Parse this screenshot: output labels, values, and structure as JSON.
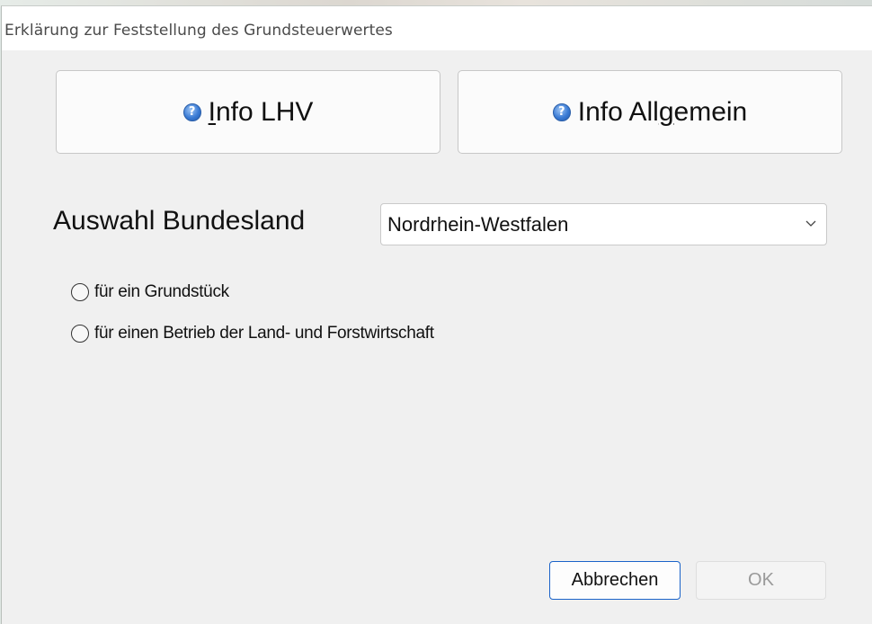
{
  "window": {
    "title": "Erklärung zur Feststellung des Grundsteuerwertes"
  },
  "info_buttons": [
    {
      "label_underlined": "I",
      "label_rest": "nfo LHV",
      "icon": "help-icon"
    },
    {
      "label_pre": "Info All",
      "label_underlined": "g",
      "label_rest": "emein",
      "icon": "help-icon"
    }
  ],
  "state": {
    "label": "Auswahl Bundesland",
    "selected": "Nordrhein-Westfalen"
  },
  "options": [
    {
      "label": "für ein Grundstück",
      "checked": false
    },
    {
      "label": "für einen Betrieb der Land- und Forstwirtschaft",
      "checked": false
    }
  ],
  "actions": {
    "cancel": "Abbrechen",
    "ok": "OK"
  },
  "icon_glyph": "?",
  "colors": {
    "accent": "#1a63c9",
    "help_icon": "#3a7bd5",
    "disabled_text": "#9a9a9a"
  }
}
